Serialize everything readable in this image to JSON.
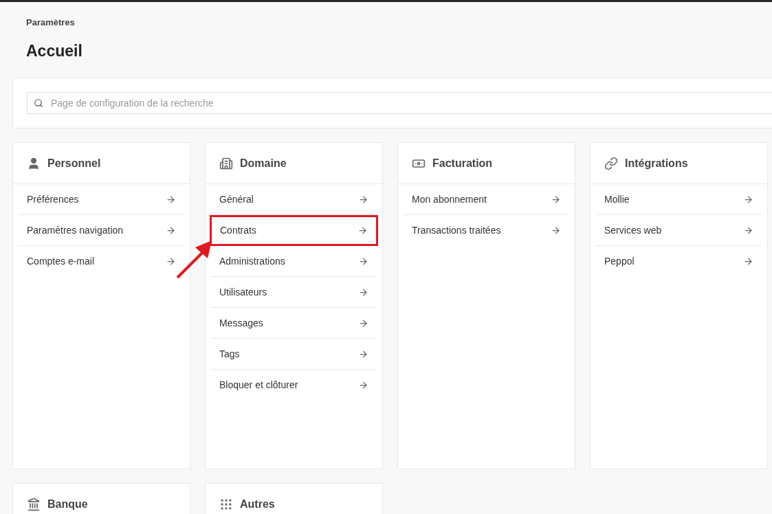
{
  "breadcrumb": "Paramètres",
  "title": "Accueil",
  "search": {
    "placeholder": "Page de configuration de la recherche"
  },
  "sections": [
    {
      "kind": "person",
      "title": "Personnel",
      "items": [
        {
          "label": "Préférences",
          "highlighted": false
        },
        {
          "label": "Paramètres navigation",
          "highlighted": false
        },
        {
          "label": "Comptes e-mail",
          "highlighted": false
        }
      ]
    },
    {
      "kind": "building",
      "title": "Domaine",
      "items": [
        {
          "label": "Général",
          "highlighted": false
        },
        {
          "label": "Contrats",
          "highlighted": true
        },
        {
          "label": "Administrations",
          "highlighted": false
        },
        {
          "label": "Utilisateurs",
          "highlighted": false
        },
        {
          "label": "Messages",
          "highlighted": false
        },
        {
          "label": "Tags",
          "highlighted": false
        },
        {
          "label": "Bloquer et clôturer",
          "highlighted": false
        }
      ]
    },
    {
      "kind": "billing",
      "title": "Facturation",
      "items": [
        {
          "label": "Mon abonnement",
          "highlighted": false
        },
        {
          "label": "Transactions traitées",
          "highlighted": false
        }
      ]
    },
    {
      "kind": "link",
      "title": "Intégrations",
      "items": [
        {
          "label": "Mollie",
          "highlighted": false
        },
        {
          "label": "Services web",
          "highlighted": false
        },
        {
          "label": "Peppol",
          "highlighted": false
        }
      ]
    },
    {
      "kind": "bank",
      "title": "Banque"
    },
    {
      "kind": "grid",
      "title": "Autres"
    }
  ]
}
